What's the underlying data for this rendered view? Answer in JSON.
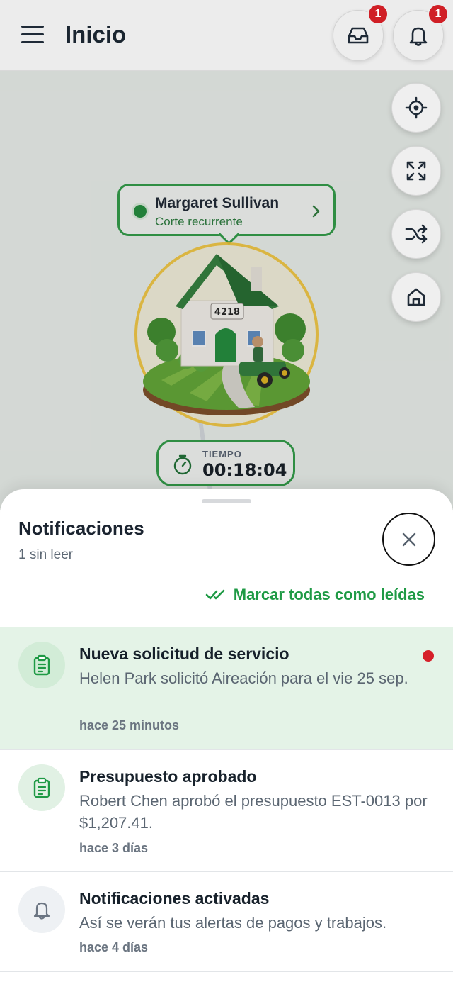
{
  "header": {
    "title": "Inicio",
    "inbox_badge": "1",
    "bell_badge": "1"
  },
  "map": {
    "client_name": "Margaret Sullivan",
    "client_service": "Corte recurrente",
    "house_number": "4218",
    "timer_label": "TIEMPO",
    "timer_value": "00:18:04"
  },
  "sheet": {
    "title": "Notificaciones",
    "subtitle": "1 sin leer",
    "mark_all_label": "Marcar todas como leídas",
    "items": [
      {
        "title": "Nueva solicitud de servicio",
        "body": "Helen Park solicitó Aireación para el vie 25 sep.",
        "time": "hace 25 minutos",
        "unread": true,
        "icon": "clipboard-icon"
      },
      {
        "title": "Presupuesto aprobado",
        "body": "Robert Chen aprobó el presupuesto EST-0013 por $1,207.41.",
        "time": "hace 3 días",
        "unread": false,
        "icon": "clipboard-icon"
      },
      {
        "title": "Notificaciones activadas",
        "body": "Así se verán tus alertas de pagos y trabajos.",
        "time": "hace 4 días",
        "unread": false,
        "icon": "bell-icon"
      }
    ]
  },
  "colors": {
    "accent_green": "#1f9a45",
    "unread_bg": "#e4f3e7",
    "badge_red": "#d01f26"
  }
}
